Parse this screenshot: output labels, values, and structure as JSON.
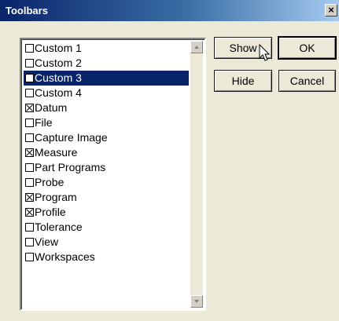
{
  "window": {
    "title": "Toolbars",
    "close_glyph": "×",
    "close_icon": "close-icon"
  },
  "toolbars_list": {
    "selected_index": 2,
    "items": [
      {
        "label": "Custom 1",
        "checked": false
      },
      {
        "label": "Custom 2",
        "checked": false
      },
      {
        "label": "Custom 3",
        "checked": false
      },
      {
        "label": "Custom 4",
        "checked": false
      },
      {
        "label": "Datum",
        "checked": true
      },
      {
        "label": "File",
        "checked": false
      },
      {
        "label": "Capture Image",
        "checked": false
      },
      {
        "label": "Measure",
        "checked": true
      },
      {
        "label": "Part Programs",
        "checked": false
      },
      {
        "label": "Probe",
        "checked": false
      },
      {
        "label": "Program",
        "checked": true
      },
      {
        "label": "Profile",
        "checked": true
      },
      {
        "label": "Tolerance",
        "checked": false
      },
      {
        "label": "View",
        "checked": false
      },
      {
        "label": "Workspaces",
        "checked": false
      }
    ]
  },
  "buttons": {
    "show_label": "Show",
    "ok_label": "OK",
    "hide_label": "Hide",
    "cancel_label": "Cancel"
  },
  "icons": {
    "scroll_up": "scroll-up-arrow-icon",
    "scroll_down": "scroll-down-arrow-icon",
    "cursor": "mouse-pointer-icon"
  },
  "colors": {
    "selection": "#0a246a",
    "dialog_background": "#ece9d8",
    "titlebar_start": "#0a246a",
    "titlebar_end": "#a6caf0"
  }
}
